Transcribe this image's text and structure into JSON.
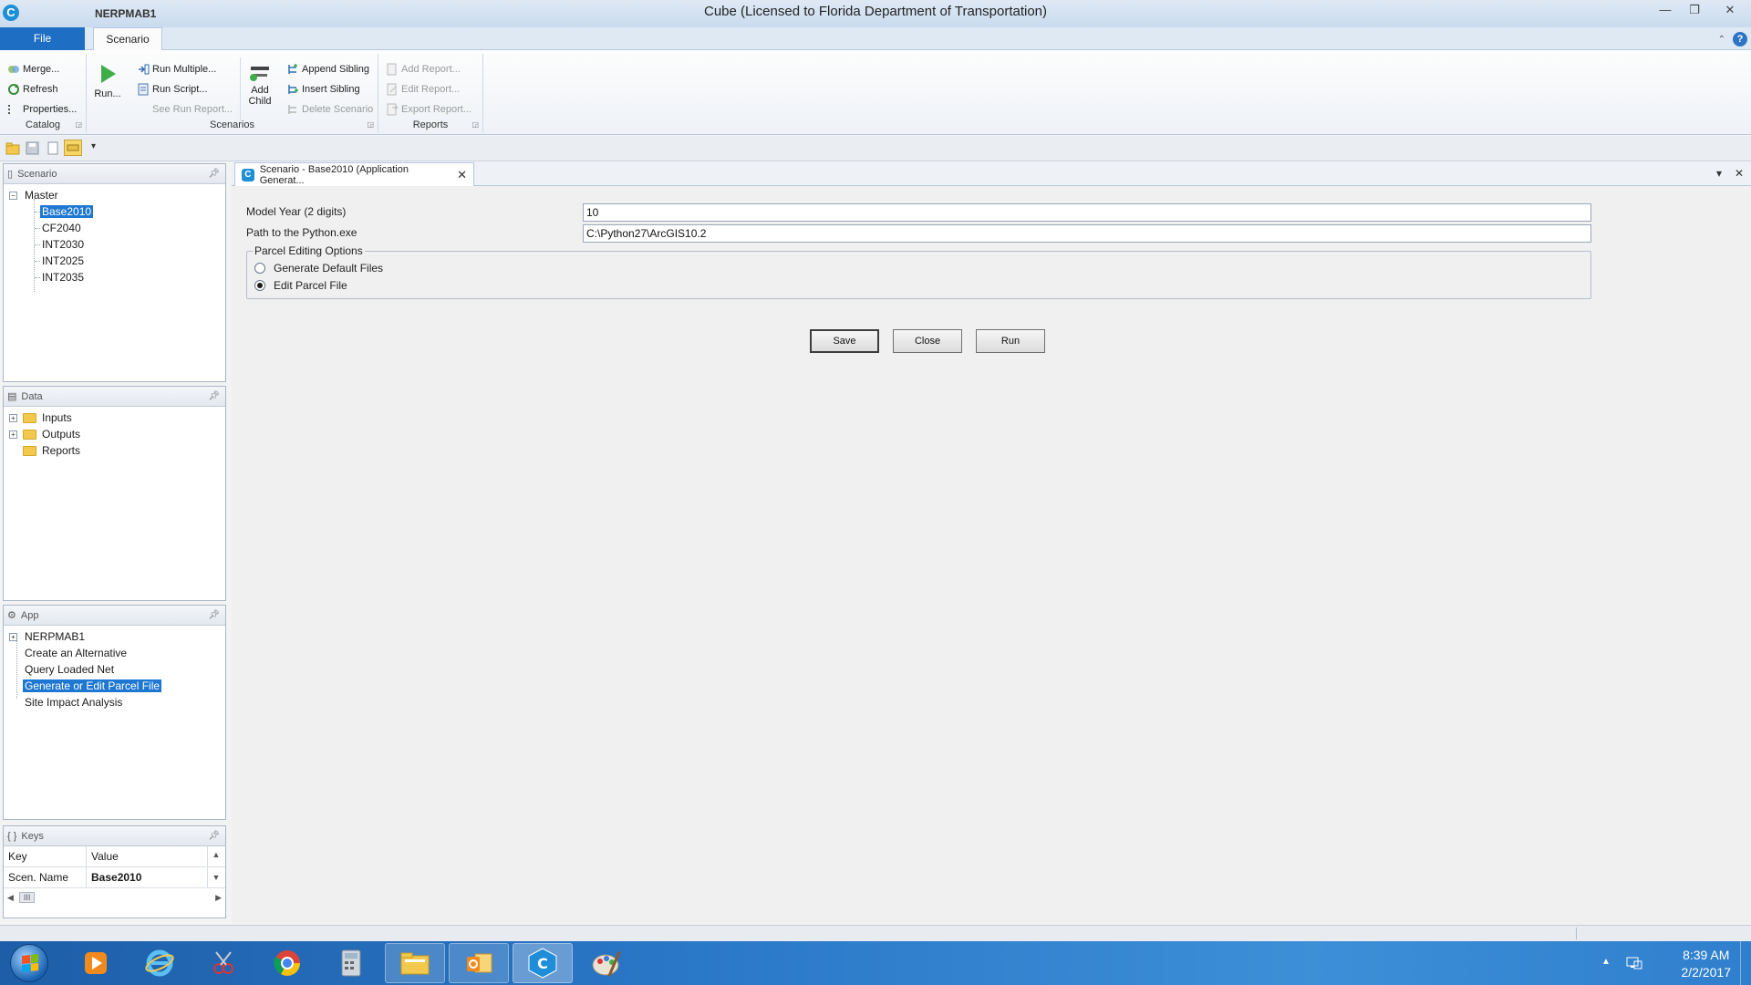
{
  "window": {
    "app_icon_letter": "C",
    "qat_title": "NERPMAB1",
    "title": "Cube (Licensed to Florida Department of Transportation)",
    "minimize": "—",
    "restore": "❐",
    "close": "✕"
  },
  "ribbon_tabs": {
    "file": "File",
    "scenario": "Scenario",
    "help": "?"
  },
  "ribbon": {
    "catalog": {
      "label": "Catalog",
      "items": [
        "Merge...",
        "Refresh",
        "Properties..."
      ]
    },
    "scenarios": {
      "label": "Scenarios",
      "run": "Run...",
      "run_multiple": "Run Multiple...",
      "run_script": "Run Script...",
      "see_run_report": "See Run Report...",
      "add_child_line1": "Add",
      "add_child_line2": "Child",
      "append_sibling": "Append Sibling",
      "insert_sibling": "Insert Sibling",
      "delete_scenario": "Delete Scenario"
    },
    "reports": {
      "label": "Reports",
      "add_report": "Add Report...",
      "edit_report": "Edit Report...",
      "export_report": "Export Report..."
    }
  },
  "panels": {
    "scenario": {
      "title": "Scenario",
      "root": "Master",
      "items": [
        "Base2010",
        "CF2040",
        "INT2030",
        "INT2025",
        "INT2035"
      ],
      "selected": "Base2010"
    },
    "data": {
      "title": "Data",
      "items": [
        "Inputs",
        "Outputs",
        "Reports"
      ]
    },
    "app": {
      "title": "App",
      "items": [
        "NERPMAB1",
        "Create an Alternative",
        "Query Loaded Net",
        "Generate or Edit Parcel File",
        "Site Impact Analysis"
      ],
      "selected": "Generate or Edit Parcel File"
    },
    "keys": {
      "title": "Keys",
      "col_key": "Key",
      "col_value": "Value",
      "rows": [
        {
          "key": "Scen. Name",
          "value": "Base2010"
        }
      ],
      "scroll_thumb": "III"
    }
  },
  "document": {
    "tab_title": "Scenario - Base2010 (Application Generat...",
    "tab_close": "✕",
    "menu_down": "▾",
    "close_all": "✕",
    "model_year_label": "Model Year (2 digits)",
    "model_year_value": "10",
    "python_path_label": "Path to the Python.exe",
    "python_path_value": "C:\\Python27\\ArcGIS10.2",
    "options_title": "Parcel Editing Options",
    "option_generate": "Generate Default Files",
    "option_edit": "Edit Parcel File",
    "selected_option": "Edit Parcel File",
    "buttons": {
      "save": "Save",
      "close": "Close",
      "run": "Run"
    }
  },
  "taskbar": {
    "time": "8:39 AM",
    "date": "2/2/2017",
    "apps": [
      "media-player",
      "internet-explorer",
      "snipping-tool",
      "chrome",
      "calculator",
      "file-explorer",
      "outlook",
      "cube",
      "paint"
    ],
    "active_app": "cube"
  },
  "colors": {
    "accent": "#1e6fc3",
    "selection": "#1e78d2",
    "taskbar": "#2a78c8"
  }
}
